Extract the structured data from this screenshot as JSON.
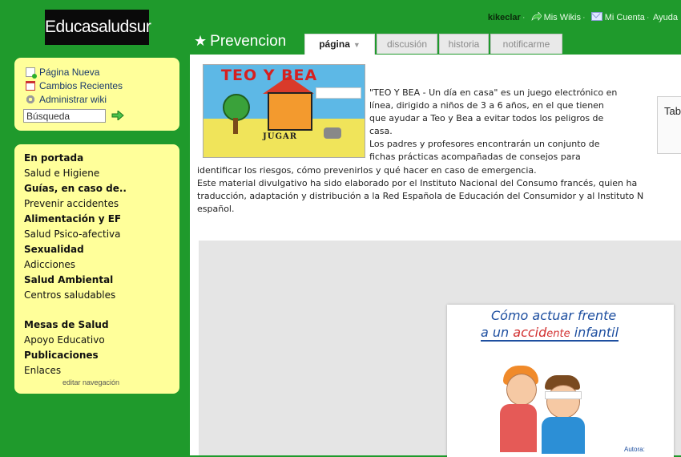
{
  "site": {
    "logo": "Educasaludsur"
  },
  "userbar": {
    "username": "kikeclar",
    "links": [
      "Mis Wikis",
      "Mi Cuenta",
      "Ayuda"
    ]
  },
  "page": {
    "title": "Prevencion"
  },
  "tabs": [
    {
      "label": "página",
      "active": true
    },
    {
      "label": "discusión"
    },
    {
      "label": "historia"
    },
    {
      "label": "notificarme"
    }
  ],
  "tools": {
    "items": [
      {
        "label": "Página Nueva",
        "icon": "new-page-icon"
      },
      {
        "label": "Cambios Recientes",
        "icon": "calendar-icon"
      },
      {
        "label": "Administrar wiki",
        "icon": "gear-icon"
      }
    ],
    "search_value": "Búsqueda"
  },
  "navigation": {
    "items": [
      {
        "label": "En portada",
        "bold": true
      },
      {
        "label": "Salud e Higiene"
      },
      {
        "label": "Guías, en caso de..",
        "bold": true
      },
      {
        "label": "Prevenir accidentes"
      },
      {
        "label": "Alimentación y EF",
        "bold": true
      },
      {
        "label": "Salud Psico-afectiva"
      },
      {
        "label": "Sexualidad",
        "bold": true
      },
      {
        "label": "Adicciones"
      },
      {
        "label": "Salud Ambiental",
        "bold": true
      },
      {
        "label": "Centros saludables"
      },
      {
        "label": "Mesas de Salud",
        "bold": true
      },
      {
        "label": "Apoyo Educativo"
      },
      {
        "label": "Publicaciones",
        "bold": true
      },
      {
        "label": "Enlaces"
      }
    ],
    "edit_label": "editar navegación"
  },
  "content": {
    "banner": {
      "title": "TEO Y BEA",
      "button": "JUGAR"
    },
    "intro_lines": [
      "\"TEO Y BEA - Un día en casa\" es un juego electrónico en",
      "línea, dirigido a niños de 3 a 6 años, en el que tienen",
      "que ayudar a Teo y Bea a evitar todos los peligros de",
      "casa.",
      "Los padres y profesores encontrarán un conjunto de",
      "fichas prácticas acompañadas de consejos para",
      "identificar los riesgos, cómo prevenirlos y qué hacer en caso de emergencia.",
      "Este material divulgativo ha sido elaborado por el Instituto Nacional del Consumo francés, quien ha",
      "traducción, adaptación y distribución a la Red Española de Educación del Consumidor y al Instituto N",
      "español."
    ],
    "table_label": "Tab",
    "book": {
      "line1": "Cómo actuar frente",
      "line2_a": "a un ",
      "line2_b": "accid",
      "line2_c": "ente",
      "line2_d": " infantil",
      "author": "Autora:"
    }
  },
  "colors": {
    "background": "#1f9a2c",
    "sidebar": "#ffff9a",
    "link": "#1a3a6c"
  }
}
